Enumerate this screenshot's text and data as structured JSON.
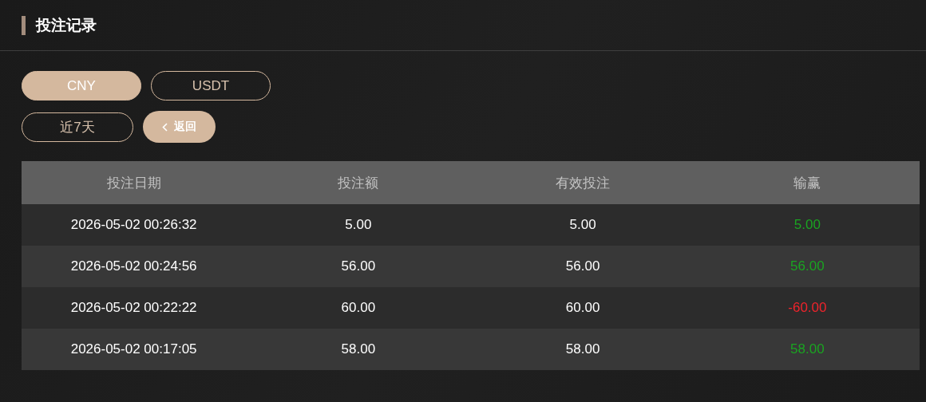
{
  "page": {
    "title": "投注记录"
  },
  "currencies": [
    {
      "label": "CNY",
      "selected": true
    },
    {
      "label": "USDT",
      "selected": false
    }
  ],
  "range": {
    "label": "近7天"
  },
  "back_button": {
    "label": "返回"
  },
  "table": {
    "columns": [
      "投注日期",
      "投注额",
      "有效投注",
      "输赢"
    ],
    "rows": [
      {
        "date": "2026-05-02 00:26:32",
        "amount": "5.00",
        "valid": "5.00",
        "win": {
          "text": "5.00",
          "color": "#1aa421"
        }
      },
      {
        "date": "2026-05-02 00:24:56",
        "amount": "56.00",
        "valid": "56.00",
        "win": {
          "text": "56.00",
          "color": "#1aa421"
        }
      },
      {
        "date": "2026-05-02 00:22:22",
        "amount": "60.00",
        "valid": "60.00",
        "win": {
          "text": "-60.00",
          "color": "#f0232b"
        }
      },
      {
        "date": "2026-05-02 00:17:05",
        "amount": "58.00",
        "valid": "58.00",
        "win": {
          "text": "58.00",
          "color": "#1aa421"
        }
      }
    ]
  }
}
